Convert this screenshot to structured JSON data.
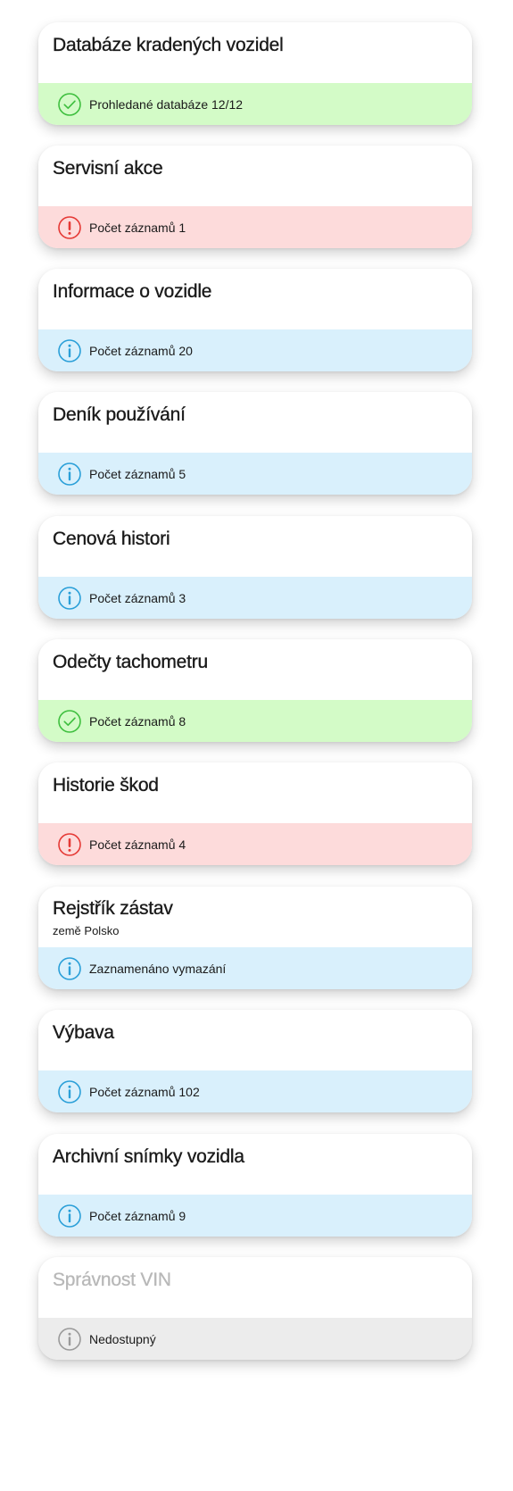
{
  "cards": [
    {
      "title": "Databáze kradených vozidel",
      "subtitle": "",
      "status": "ok",
      "status_text": "Prohledané databáze 12/12"
    },
    {
      "title": "Servisní akce",
      "subtitle": "",
      "status": "error",
      "status_text": "Počet záznamů 1"
    },
    {
      "title": "Informace o vozidle",
      "subtitle": "",
      "status": "info",
      "status_text": "Počet záznamů 20"
    },
    {
      "title": "Deník používání",
      "subtitle": "",
      "status": "info",
      "status_text": "Počet záznamů 5"
    },
    {
      "title": "Cenová histori",
      "subtitle": "",
      "status": "info",
      "status_text": "Počet záznamů 3"
    },
    {
      "title": "Odečty tachometru",
      "subtitle": "",
      "status": "ok",
      "status_text": "Počet záznamů 8"
    },
    {
      "title": "Historie škod",
      "subtitle": "",
      "status": "error",
      "status_text": "Počet záznamů 4"
    },
    {
      "title": "Rejstřík zástav",
      "subtitle": "země Polsko",
      "status": "info",
      "status_text": "Zaznamenáno vymazání"
    },
    {
      "title": "Výbava",
      "subtitle": "",
      "status": "info",
      "status_text": "Počet záznamů 102"
    },
    {
      "title": "Archivní snímky vozidla",
      "subtitle": "",
      "status": "info",
      "status_text": "Počet záznamů 9"
    },
    {
      "title": "Správnost VIN",
      "subtitle": "",
      "status": "unavailable",
      "status_text": "Nedostupný"
    }
  ],
  "colors": {
    "ok_bg": "#d3fbc7",
    "ok_icon": "#3fbf3f",
    "error_bg": "#fddbdb",
    "error_icon": "#e53935",
    "info_bg": "#d9f0fc",
    "info_icon": "#2a9fd8",
    "unavailable_bg": "#ececec",
    "unavailable_icon": "#9a9a9a"
  },
  "icons": {
    "ok": "check-circle-icon",
    "error": "exclamation-circle-icon",
    "info": "info-circle-icon",
    "unavailable": "info-circle-icon"
  }
}
